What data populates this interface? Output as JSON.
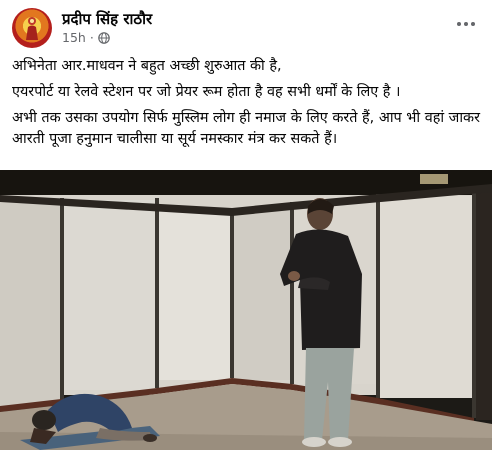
{
  "post": {
    "author": "प्रदीप सिंह राठौर",
    "timestamp": "15h",
    "separator": "·",
    "audience_icon": "globe-icon",
    "more_icon": "more-options-icon",
    "paragraphs": [
      "अभिनेता आर.माधवन ने बहुत अच्छी शुरुआत की है,",
      "एयरपोर्ट या रेलवे स्टेशन पर जो प्रेयर रूम होता है वह सभी धर्मों के लिए है ।",
      "अभी तक उसका उपयोग सिर्फ मुस्लिम लोग ही नमाज के लिए करते हैं, आप भी वहां जाकर आरती पूजा हनुमान चालीसा या सूर्य नमस्कार मंत्र कर सकते हैं।"
    ]
  },
  "colors": {
    "name": "#050505",
    "secondary": "#65676b",
    "avatar_ring": "#b41f1c",
    "avatar_inner": "#f6d04d"
  }
}
